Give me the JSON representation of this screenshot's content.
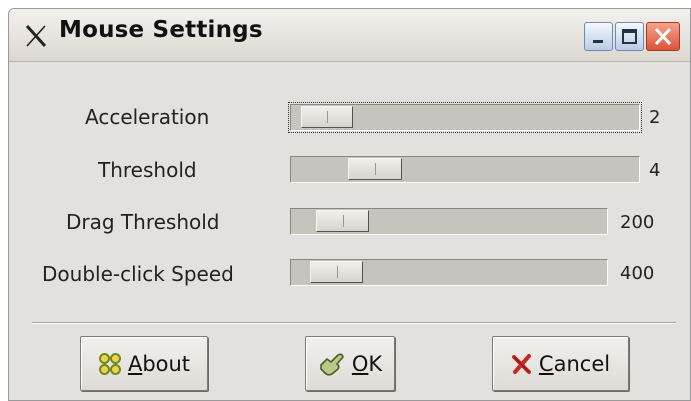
{
  "window": {
    "title": "Mouse Settings"
  },
  "settings": [
    {
      "label": "Acceleration",
      "value": "2",
      "level": 0.03
    },
    {
      "label": "Threshold",
      "value": "4",
      "level": 0.17
    },
    {
      "label": "Drag Threshold",
      "value": "200",
      "level": 0.07
    },
    {
      "label": "Double-click Speed",
      "value": "400",
      "level": 0.05
    }
  ],
  "buttons": {
    "about": {
      "mnemonic": "A",
      "rest": "bout"
    },
    "ok": {
      "mnemonic": "O",
      "rest": "K"
    },
    "cancel": {
      "mnemonic": "C",
      "rest": "ancel"
    }
  },
  "icons": {
    "app": "x-logo-icon",
    "minimize": "minimize-icon",
    "maximize": "maximize-icon",
    "close": "close-icon",
    "about": "about-icon",
    "ok": "ok-hand-icon",
    "cancel": "cancel-x-icon"
  },
  "colors": {
    "window_bg": "#e3e1dd",
    "close_button": "#dc5439",
    "title_buttons": "#bccbe6"
  }
}
